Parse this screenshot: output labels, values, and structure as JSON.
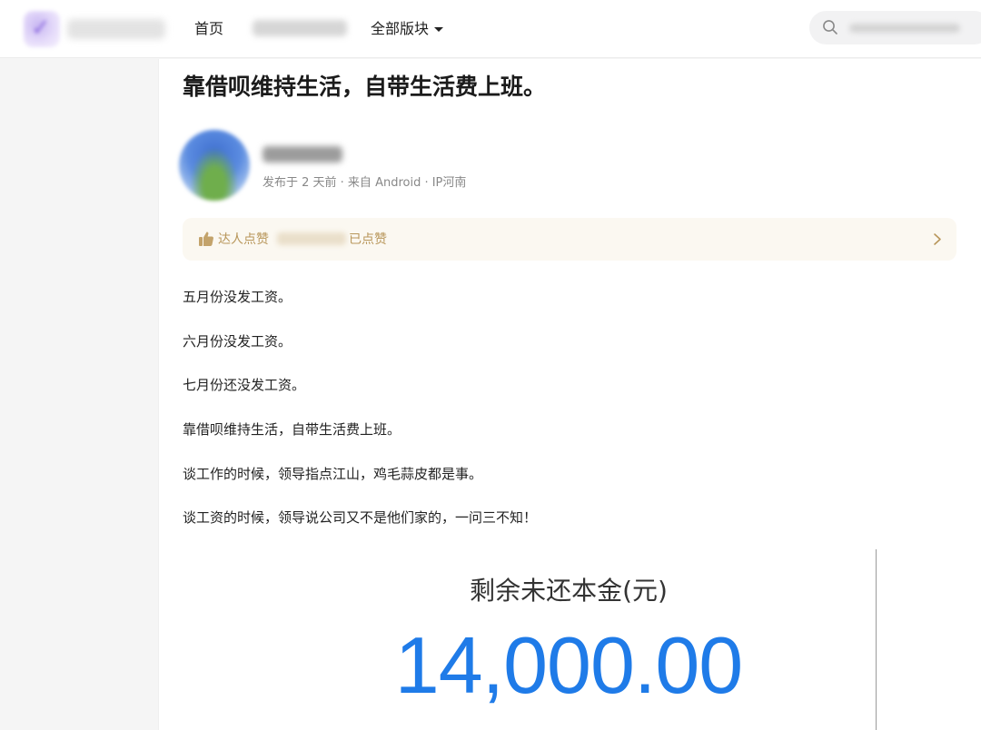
{
  "header": {
    "nav": {
      "home": "首页",
      "all_sections": "全部版块"
    },
    "icons": {
      "search": "search-icon",
      "dropdown": "caret-down-icon"
    }
  },
  "post": {
    "title": "靠借呗维持生活，自带生活费上班。",
    "meta": "发布于 2 天前 · 来自 Android · IP河南",
    "likes": {
      "prefix": "达人点赞",
      "suffix": "已点赞",
      "icon": "thumbs-up-icon"
    },
    "paragraphs": [
      "五月份没发工资。",
      "六月份没发工资。",
      "七月份还没发工资。",
      "靠借呗维持生活，自带生活费上班。",
      "谈工作的时候，领导指点江山，鸡毛蒜皮都是事。",
      "谈工资的时候，领导说公司又不是他们家的，一问三不知！"
    ],
    "embed": {
      "label": "剩余未还本金(元)",
      "amount": "14,000.00"
    }
  },
  "colors": {
    "accent_gold": "#b8965a",
    "amount_blue": "#1f7be8",
    "likes_bg": "#fbf8f1"
  }
}
